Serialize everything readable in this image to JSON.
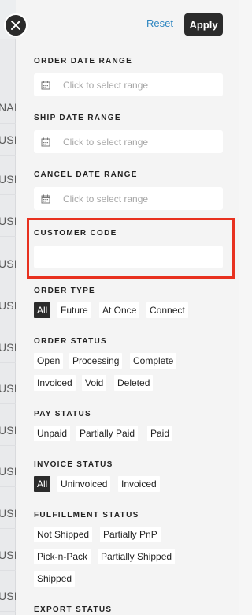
{
  "background": {
    "rows": [
      "NAI",
      "USD",
      "USD",
      "USD",
      "USD",
      "USD",
      "USD",
      "USD",
      "USD",
      "USD",
      "USD",
      "USD",
      "USD",
      "USD"
    ]
  },
  "header": {
    "reset_label": "Reset",
    "apply_label": "Apply"
  },
  "filters": {
    "order_date": {
      "title": "ORDER DATE RANGE",
      "placeholder": "Click to select range"
    },
    "ship_date": {
      "title": "SHIP DATE RANGE",
      "placeholder": "Click to select range"
    },
    "cancel_date": {
      "title": "CANCEL DATE RANGE",
      "placeholder": "Click to select range"
    },
    "customer_code": {
      "title": "CUSTOMER CODE",
      "value": ""
    },
    "order_type": {
      "title": "ORDER TYPE",
      "options": [
        "All",
        "Future",
        "At Once",
        "Connect"
      ],
      "selected": "All"
    },
    "order_status": {
      "title": "ORDER STATUS",
      "options": [
        "Open",
        "Processing",
        "Complete",
        "Invoiced",
        "Void",
        "Deleted"
      ]
    },
    "pay_status": {
      "title": "PAY STATUS",
      "options": [
        "Unpaid",
        "Partially Paid",
        "Paid"
      ]
    },
    "invoice_status": {
      "title": "INVOICE STATUS",
      "options": [
        "All",
        "Uninvoiced",
        "Invoiced"
      ],
      "selected": "All"
    },
    "fulfillment_status": {
      "title": "FULFILLMENT STATUS",
      "options": [
        "Not Shipped",
        "Partially PnP",
        "Pick-n-Pack",
        "Partially Shipped",
        "Shipped"
      ]
    },
    "export_status": {
      "title": "EXPORT STATUS"
    }
  },
  "colors": {
    "accent_link": "#2e86c1",
    "dark": "#2b2b2b",
    "highlight": "#e8311f"
  }
}
